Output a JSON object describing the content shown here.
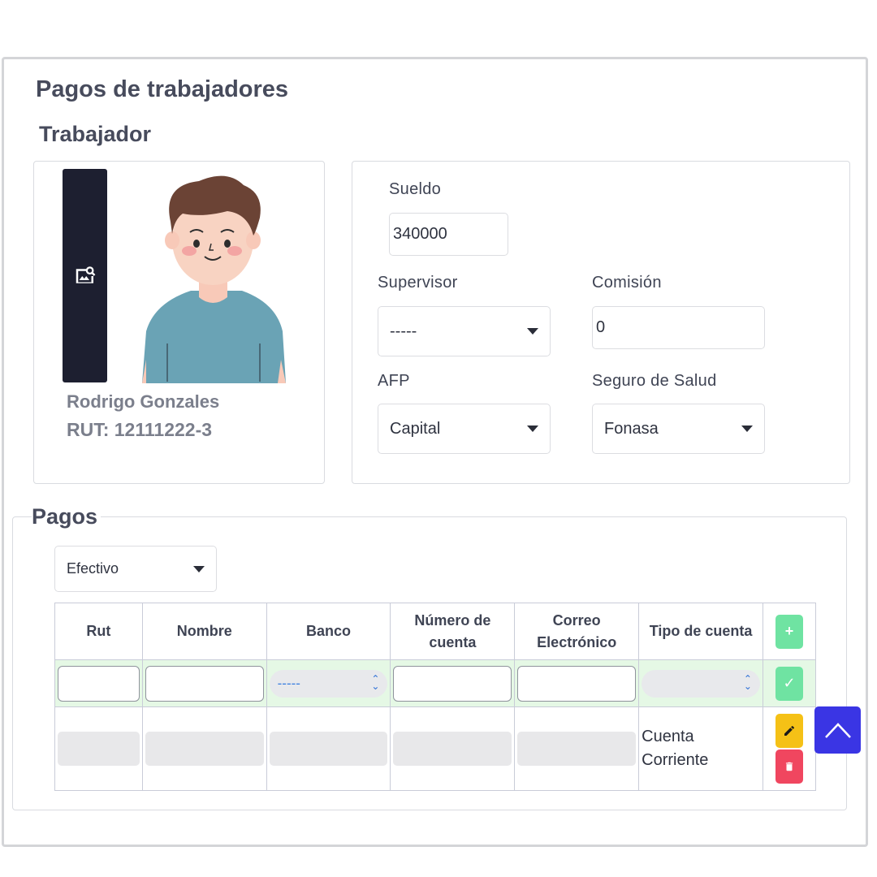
{
  "header": {
    "title": "Pagos de trabajadores",
    "section": "Trabajador"
  },
  "worker": {
    "name": "Rodrigo Gonzales",
    "rut": "RUT: 12111222-3"
  },
  "form": {
    "sueldo": {
      "label": "Sueldo",
      "value": "340000"
    },
    "supervisor": {
      "label": "Supervisor",
      "value": "-----"
    },
    "comision": {
      "label": "Comisión",
      "value": "0"
    },
    "afp": {
      "label": "AFP",
      "value": "Capital"
    },
    "seguro": {
      "label": "Seguro de Salud",
      "value": "Fonasa"
    }
  },
  "pagos": {
    "title": "Pagos",
    "method": "Efectivo",
    "columns": [
      "Rut",
      "Nombre",
      "Banco",
      "Número de cuenta",
      "Correo Electrónico",
      "Tipo de cuenta"
    ],
    "col_lines": {
      "numero1": "Número de",
      "numero2": "cuenta",
      "correo1": "Correo",
      "correo2": "Electrónico"
    },
    "input_row": {
      "banco_select": "-----"
    },
    "rows": [
      {
        "tipo_cuenta_1": "Cuenta",
        "tipo_cuenta_2": "Corriente"
      }
    ],
    "buttons": {
      "add": "+",
      "confirm": "✓"
    }
  },
  "colors": {
    "accent": "#3a35e4",
    "success": "#6fe3a2",
    "warning": "#f5c116",
    "danger": "#f0465f",
    "dark": "#1d1f30"
  }
}
